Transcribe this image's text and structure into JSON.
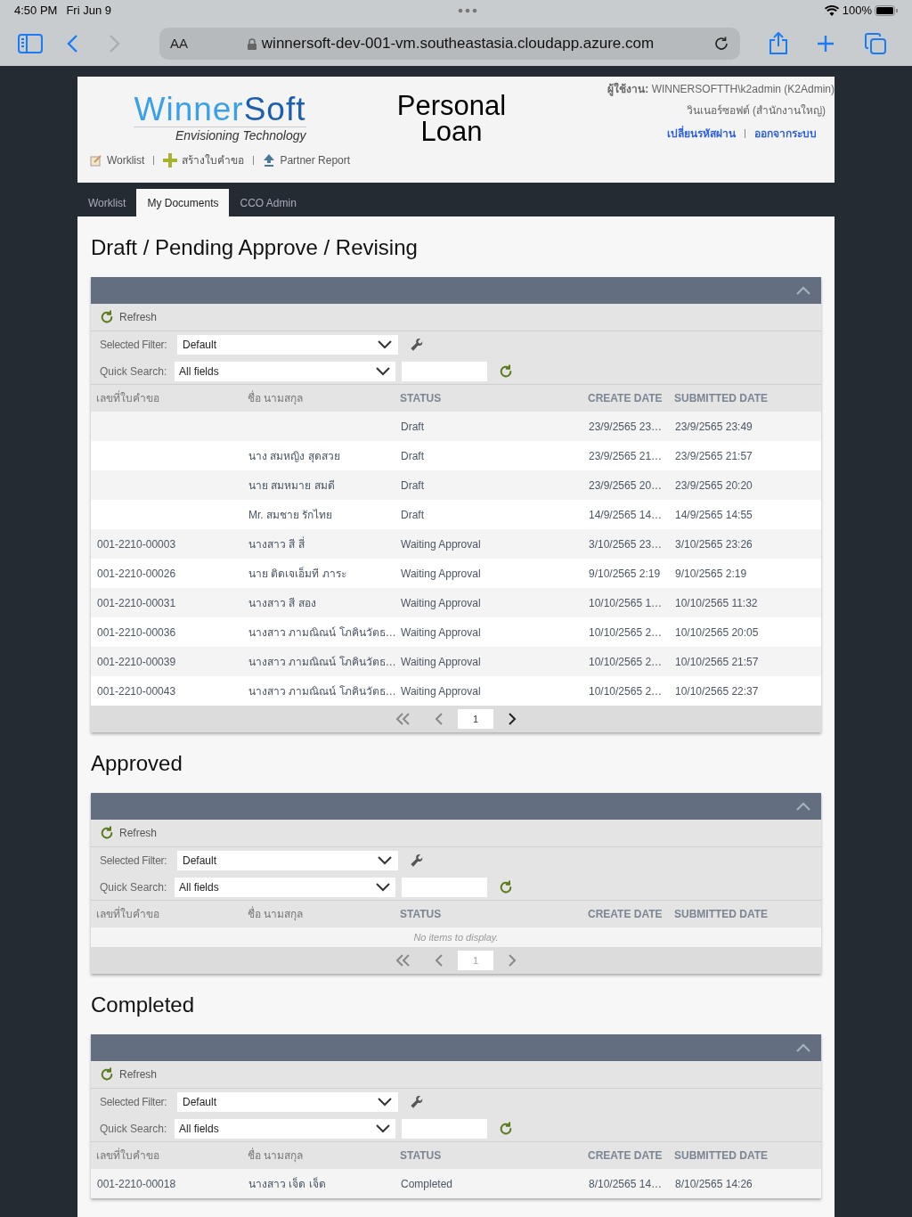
{
  "status_bar": {
    "time": "4:50 PM",
    "date": "Fri Jun 9",
    "battery": "100%"
  },
  "browser": {
    "text_size": "AA",
    "url": "winnersoft-dev-001-vm.southeastasia.cloudapp.azure.com",
    "forward_enabled": false
  },
  "header": {
    "logo": {
      "name_part1": "Winner",
      "name_part2": "Soft",
      "tagline": "Envisioning Technology"
    },
    "nav_links": [
      {
        "kind": "worklist",
        "label": "Worklist"
      },
      {
        "kind": "create",
        "label": "สร้างใบคำขอ"
      },
      {
        "kind": "report",
        "label": "Partner Report"
      }
    ],
    "app_title_line1": "Personal",
    "app_title_line2": "Loan",
    "user_label": "ผู้ใช้งาน:",
    "user": "WINNERSOFTTH\\k2admin (K2Admin)",
    "org": "วินเนอร์ซอฟต์ (สำนักงานใหญ่)",
    "user_links": [
      "เปลี่ยนรหัสผ่าน",
      "ออกจากระบบ"
    ]
  },
  "tabs": [
    {
      "label": "Worklist",
      "selected": false
    },
    {
      "label": "My Documents",
      "selected": true
    },
    {
      "label": "CCO Admin",
      "selected": false
    }
  ],
  "sections": [
    {
      "title": "Draft / Pending Approve / Revising",
      "refresh": "Refresh",
      "filter_label": "Selected Filter:",
      "filter_value": "Default",
      "search_label": "Quick Search:",
      "search_value": "All fields",
      "columns": [
        "เลขที่ใบคำขอ",
        "ชื่อ นามสกุล",
        "STATUS",
        "CREATE DATE",
        "SUBMITTED DATE"
      ],
      "rows": [
        [
          "",
          "",
          "Draft",
          "23/9/2565 23…",
          "23/9/2565 23:49"
        ],
        [
          "",
          "นาง สมหญิง สุดสวย",
          "Draft",
          "23/9/2565 21…",
          "23/9/2565 21:57"
        ],
        [
          "",
          "นาย สมหมาย สมดี",
          "Draft",
          "23/9/2565 20…",
          "23/9/2565 20:20"
        ],
        [
          "",
          "Mr. สมชาย รักไทย",
          "Draft",
          "14/9/2565 14…",
          "14/9/2565 14:55"
        ],
        [
          "001-2210-00003",
          "นางสาว สี สี่",
          "Waiting Approval",
          "3/10/2565 23…",
          "3/10/2565 23:26"
        ],
        [
          "001-2210-00026",
          "นาย ติดเจเอ็มที ภาระ",
          "Waiting Approval",
          "9/10/2565 2:19",
          "9/10/2565 2:19"
        ],
        [
          "001-2210-00031",
          "นางสาว สี สอง",
          "Waiting Approval",
          "10/10/2565 1…",
          "10/10/2565 11:32"
        ],
        [
          "001-2210-00036",
          "นางสาว ภามณิณน์ โภคินวัตธ…",
          "Waiting Approval",
          "10/10/2565 2…",
          "10/10/2565 20:05"
        ],
        [
          "001-2210-00039",
          "นางสาว ภามณิณน์ โภคินวัตธ…",
          "Waiting Approval",
          "10/10/2565 2…",
          "10/10/2565 21:57"
        ],
        [
          "001-2210-00043",
          "นางสาว ภามณิณน์ โภคินวัตธ…",
          "Waiting Approval",
          "10/10/2565 2…",
          "10/10/2565 22:37"
        ]
      ],
      "pager": {
        "page": "1",
        "enabled": true
      }
    },
    {
      "title": "Approved",
      "refresh": "Refresh",
      "filter_label": "Selected Filter:",
      "filter_value": "Default",
      "search_label": "Quick Search:",
      "search_value": "All fields",
      "columns": [
        "เลขที่ใบคำขอ",
        "ชื่อ นามสกุล",
        "STATUS",
        "CREATE DATE",
        "SUBMITTED DATE"
      ],
      "empty_message": "No items to display.",
      "pager": {
        "page": "1",
        "enabled": false
      }
    },
    {
      "title": "Completed",
      "refresh": "Refresh",
      "filter_label": "Selected Filter:",
      "filter_value": "Default",
      "search_label": "Quick Search:",
      "search_value": "All fields",
      "columns": [
        "เลขที่ใบคำขอ",
        "ชื่อ นามสกุล",
        "STATUS",
        "CREATE DATE",
        "SUBMITTED DATE"
      ],
      "rows": [
        [
          "001-2210-00018",
          "นางสาว เจ็ด เจ็ด",
          "Completed",
          "8/10/2565 14…",
          "8/10/2565 14:26"
        ]
      ]
    }
  ]
}
